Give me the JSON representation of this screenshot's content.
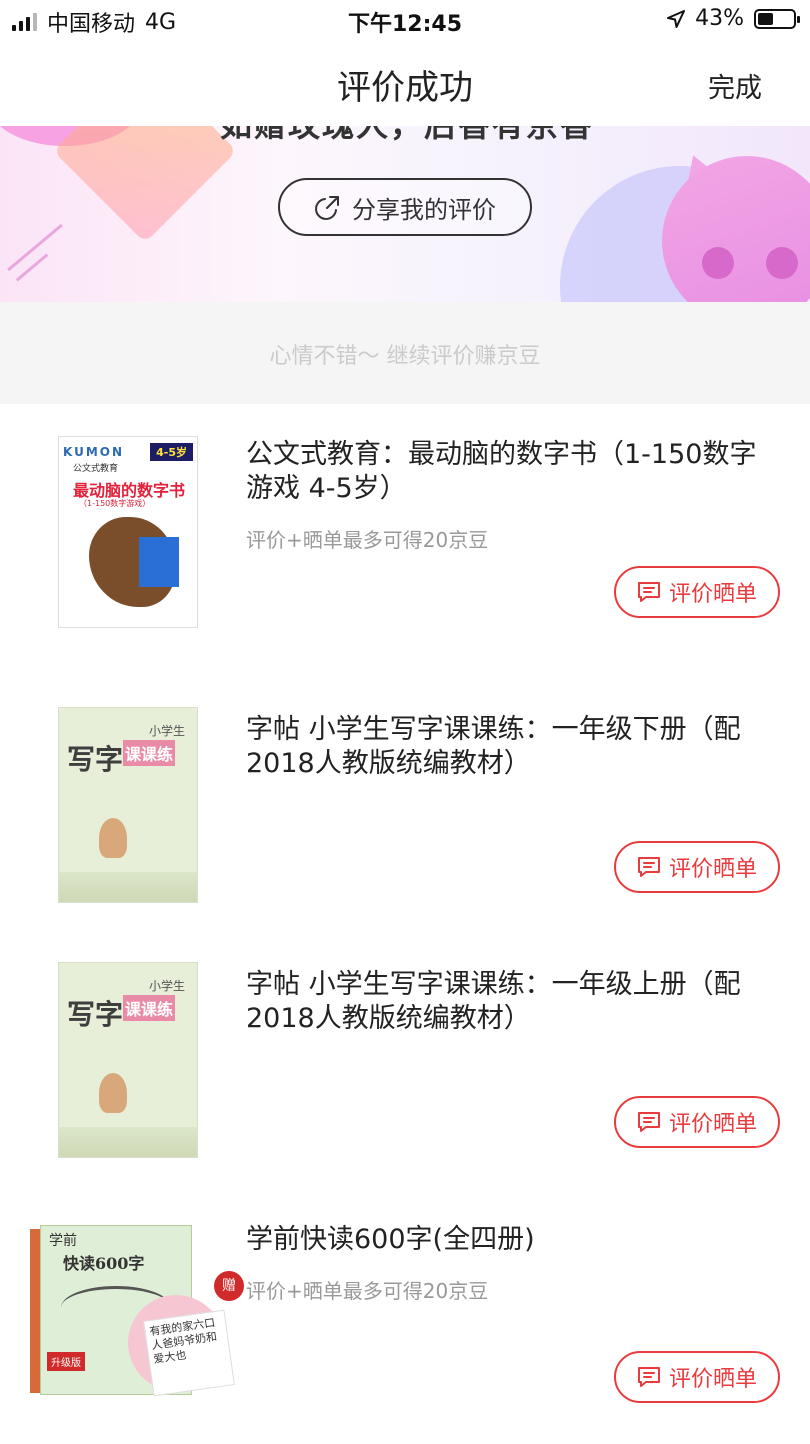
{
  "status_bar": {
    "carrier": "中国移动",
    "network": "4G",
    "time": "下午12:45",
    "battery": "43%",
    "battery_level": 0.43
  },
  "nav": {
    "title": "评价成功",
    "done_label": "完成"
  },
  "banner": {
    "partial_text": "如赠玫瑰人，后香有京香",
    "share_label": "分享我的评价"
  },
  "hint": "心情不错～ 继续评价赚京豆",
  "rate_label": "评价晒单",
  "products": [
    {
      "name": "公文式教育：最动脑的数字书（1-150数字游戏 4-5岁）",
      "reward": "评价+晒单最多可得20京豆",
      "cover": {
        "brand": "KUMON",
        "age": "4-5岁",
        "title": "最动脑的数字书",
        "subtitle": "（1-150数字游戏）",
        "series": "公文式教育"
      }
    },
    {
      "name": "字帖 小学生写字课课练：一年级下册（配2018人教版统编教材）",
      "reward": "",
      "cover": {
        "big": "写字",
        "accent": "课课练",
        "small": "小学生"
      }
    },
    {
      "name": "字帖 小学生写字课课练：一年级上册（配2018人教版统编教材）",
      "reward": "",
      "cover": {
        "big": "写字",
        "accent": "课课练",
        "small": "小学生"
      }
    },
    {
      "name": "学前快读600字(全四册)",
      "reward": "评价+晒单最多可得20京豆",
      "cover": {
        "top": "学前",
        "title": "快读600字",
        "badge": "升级版",
        "gift": "赠",
        "card": "有我的家六口人爸妈爷奶和爱大也"
      }
    }
  ],
  "colors": {
    "accent": "#e93b3d",
    "hint_text": "#cbcbcb",
    "hint_bg": "#f5f5f5"
  }
}
